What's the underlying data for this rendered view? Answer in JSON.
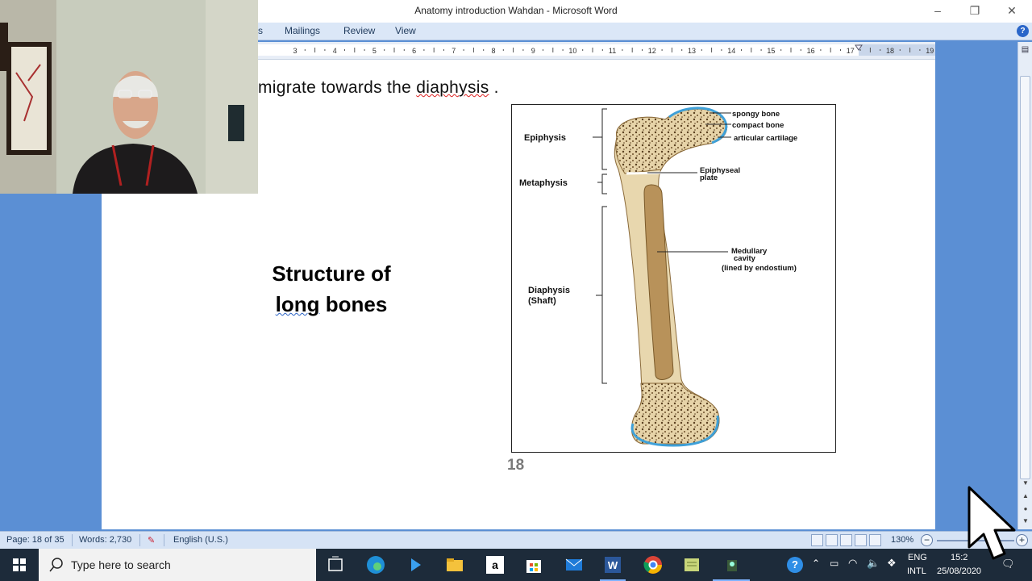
{
  "window": {
    "title": "Anatomy introduction Wahdan  -  Microsoft Word",
    "minimize_glyph": "–",
    "maximize_glyph": "❐",
    "close_glyph": "✕"
  },
  "ribbon": {
    "tabs": [
      "s",
      "Mailings",
      "Review",
      "View"
    ],
    "help_glyph": "?"
  },
  "ruler": {
    "numbers": [
      "3",
      "4",
      "5",
      "6",
      "7",
      "8",
      "9",
      "10",
      "11",
      "12",
      "13",
      "14",
      "15",
      "16",
      "17",
      "18",
      "19"
    ]
  },
  "document": {
    "line_part1": "migrate towards the ",
    "line_misspelled": "diaphysis",
    "line_part2": " .",
    "heading_line1": "Structure of",
    "heading_line2a": "long",
    "heading_line2b": " bones",
    "page_number": "18",
    "figure": {
      "labels_left": {
        "epiphysis": "Epiphysis",
        "metaphysis": "Metaphysis",
        "diaphysis": "Diaphysis",
        "shaft": "(Shaft)"
      },
      "labels_right": {
        "spongy": "spongy bone",
        "compact": "compact bone",
        "cartilage": "articular cartilage",
        "plate1": "Epiphyseal",
        "plate2": "plate",
        "medullary1": "Medullary",
        "medullary2": "cavity",
        "medullary3": "(lined by endostium)"
      }
    }
  },
  "statusbar": {
    "page": "Page: 18 of 35",
    "words": "Words: 2,730",
    "language": "English (U.S.)",
    "zoom": "130%",
    "zoom_out": "−",
    "zoom_in": "+"
  },
  "taskbar": {
    "search_placeholder": "Type here to search",
    "lang_line1": "ENG",
    "lang_line2": "INTL",
    "time": "15:2",
    "date": "25/08/2020",
    "colors": {
      "bar": "#1d2b3a",
      "accent": "#7fb3ff"
    }
  }
}
